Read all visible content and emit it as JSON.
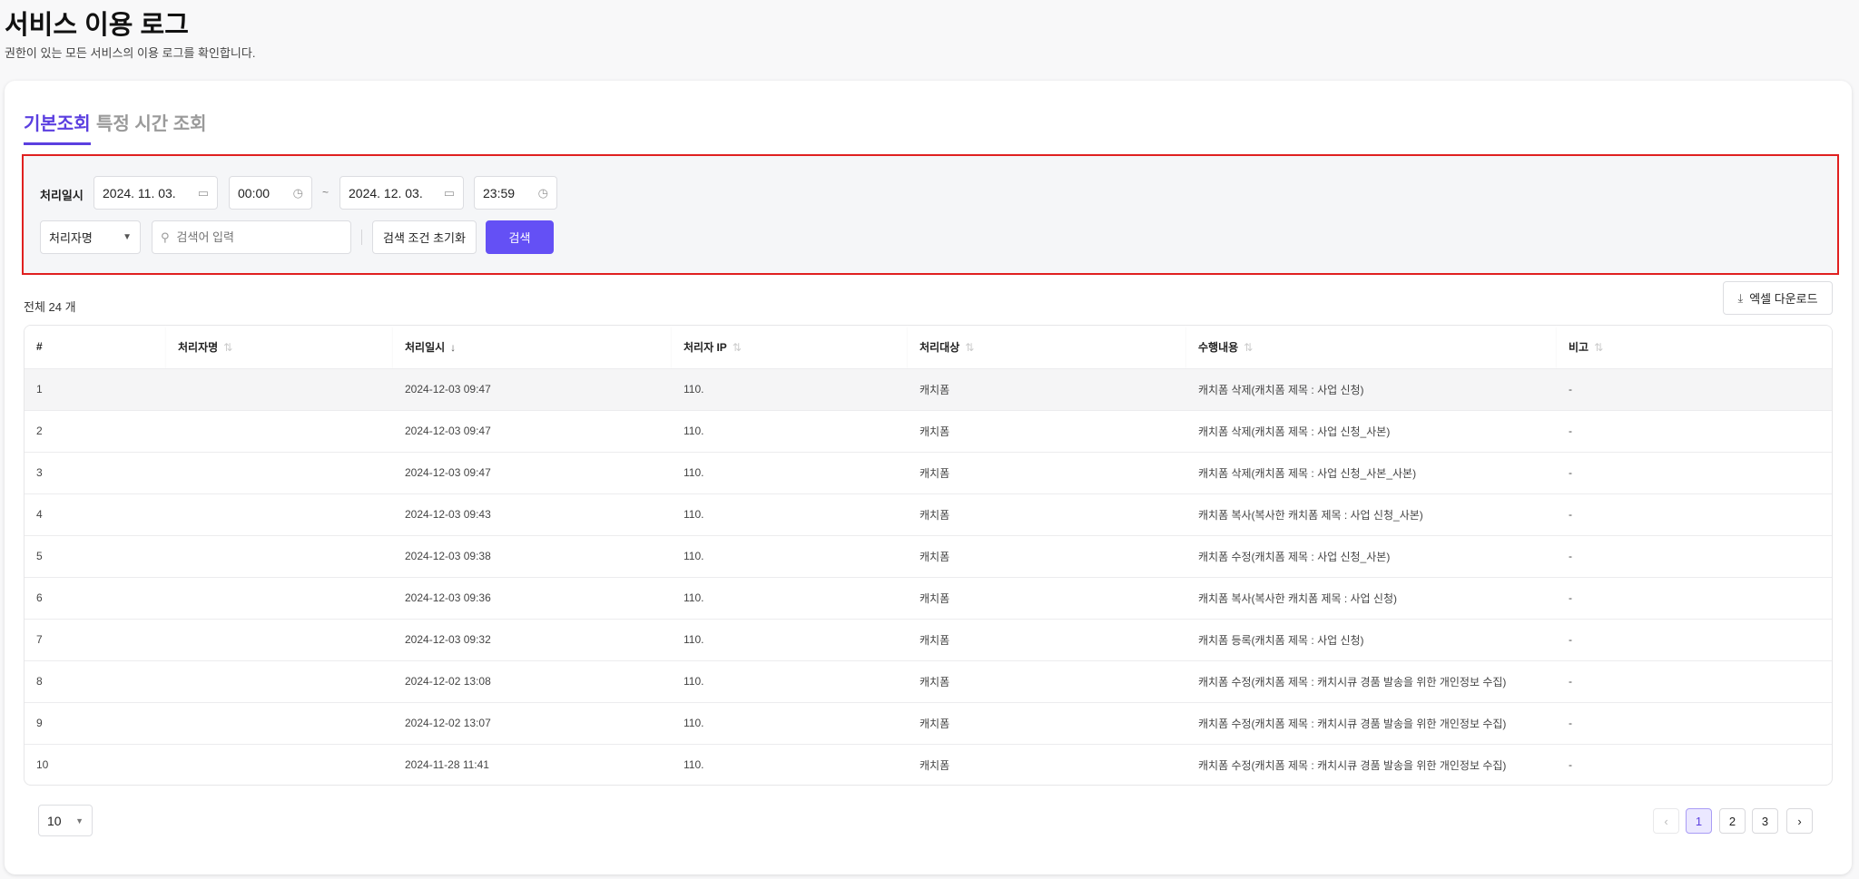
{
  "header": {
    "title": "서비스 이용 로그",
    "subtitle": "권한이 있는 모든 서비스의 이용 로그를 확인합니다."
  },
  "tabs": [
    {
      "label": "기본조회",
      "active": true
    },
    {
      "label": "특정 시간 조회",
      "active": false
    }
  ],
  "filter": {
    "date_label": "처리일시",
    "start_date": "2024. 11. 03.",
    "start_time": "00:00",
    "separator": "~",
    "end_date": "2024. 12. 03.",
    "end_time": "23:59",
    "field_select": "처리자명",
    "search_placeholder": "검색어 입력",
    "reset_label": "검색 조건 초기화",
    "search_label": "검색",
    "icons": {
      "calendar": "calendar-icon",
      "clock": "clock-icon",
      "search": "search-icon"
    }
  },
  "summary": {
    "total": "전체 24 개"
  },
  "excel_label": "엑셀 다운로드",
  "table": {
    "columns": [
      "#",
      "처리자명",
      "처리일시",
      "처리자 IP",
      "처리대상",
      "수행내용",
      "비고"
    ],
    "sorted_column": "처리일시",
    "rows": [
      [
        "1",
        "",
        "2024-12-03 09:47",
        "110.",
        "캐치폼",
        "캐치폼 삭제(캐치폼 제목 : 사업 신청)",
        "-"
      ],
      [
        "2",
        "",
        "2024-12-03 09:47",
        "110.",
        "캐치폼",
        "캐치폼 삭제(캐치폼 제목 : 사업 신청_사본)",
        "-"
      ],
      [
        "3",
        "",
        "2024-12-03 09:47",
        "110.",
        "캐치폼",
        "캐치폼 삭제(캐치폼 제목 : 사업 신청_사본_사본)",
        "-"
      ],
      [
        "4",
        "",
        "2024-12-03 09:43",
        "110.",
        "캐치폼",
        "캐치폼 복사(복사한 캐치폼 제목 : 사업 신청_사본)",
        "-"
      ],
      [
        "5",
        "",
        "2024-12-03 09:38",
        "110.",
        "캐치폼",
        "캐치폼 수정(캐치폼 제목 : 사업 신청_사본)",
        "-"
      ],
      [
        "6",
        "",
        "2024-12-03 09:36",
        "110.",
        "캐치폼",
        "캐치폼 복사(복사한 캐치폼 제목 : 사업 신청)",
        "-"
      ],
      [
        "7",
        "",
        "2024-12-03 09:32",
        "110.",
        "캐치폼",
        "캐치폼 등록(캐치폼 제목 : 사업 신청)",
        "-"
      ],
      [
        "8",
        "",
        "2024-12-02 13:08",
        "110.",
        "캐치폼",
        "캐치폼 수정(캐치폼 제목 : 캐치시큐 경품 발송을 위한 개인정보 수집)",
        "-"
      ],
      [
        "9",
        "",
        "2024-12-02 13:07",
        "110.",
        "캐치폼",
        "캐치폼 수정(캐치폼 제목 : 캐치시큐 경품 발송을 위한 개인정보 수집)",
        "-"
      ],
      [
        "10",
        "",
        "2024-11-28 11:41",
        "110.",
        "캐치폼",
        "캐치폼 수정(캐치폼 제목 : 캐치시큐 경품 발송을 위한 개인정보 수집)",
        "-"
      ]
    ]
  },
  "pagination": {
    "page_size": "10",
    "pages": [
      "1",
      "2",
      "3"
    ],
    "current": "1",
    "prev": "‹",
    "next": "›"
  },
  "colors": {
    "accent": "#6450f5",
    "highlight_border": "#e02020"
  }
}
